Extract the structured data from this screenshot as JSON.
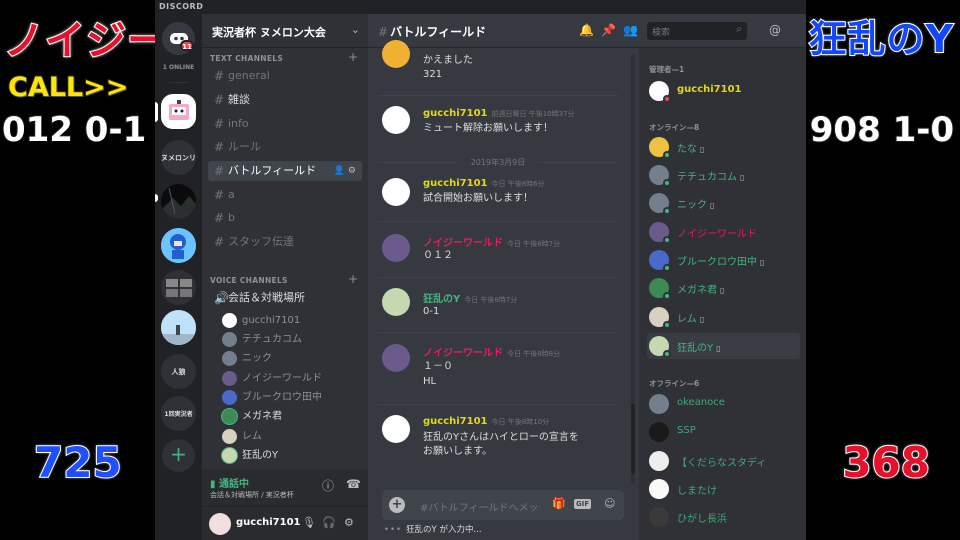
{
  "overlay": {
    "left_player": "ノイジー",
    "call": "CALL>>",
    "left_score": "012 0-1",
    "left_rate": "725",
    "right_player": "狂乱のY",
    "right_score": "908 1-0",
    "right_rate": "368"
  },
  "colors": {
    "accent_green": "#43b581",
    "mention_pink": "#e91e63",
    "name_green": "#43b581",
    "admin_yellow": "#e4d90b"
  },
  "titlebar": {
    "brand": "DISCORD"
  },
  "guilds": {
    "home_badge": "11",
    "online_label": "1 ONLINE",
    "items": [
      "ヌメロンリ",
      "人狼",
      "1回実況者"
    ]
  },
  "server": {
    "name": "実況者杯 ヌメロン大会",
    "text_category": "TEXT CHANNELS",
    "voice_category": "VOICE CHANNELS",
    "text_channels": [
      "general",
      "雑談",
      "info",
      "ルール",
      "バトルフィールド",
      "a",
      "b",
      "スタッフ伝達"
    ],
    "voice_channel": "会話＆対戦場所",
    "voice_users": [
      "gucchi7101",
      "テチュカコム",
      "ニック",
      "ノイジーワールド",
      "ブルークロウ田中",
      "メガネ君",
      "レム",
      "狂乱のY"
    ]
  },
  "voice_panel": {
    "title": "通話中",
    "subtitle": "会話＆対戦場所 / 実況者杯"
  },
  "user_panel": {
    "name": "gucchi7101"
  },
  "chat": {
    "channel": "バトルフィールド",
    "date_divider": "2019年3月9日",
    "messages": [
      {
        "text1": "かえました",
        "text2": "321"
      },
      {
        "user": "gucchi7101",
        "time": "前週日曜日 午後10時37分",
        "text1": "ミュート解除お願いします！"
      },
      {
        "user": "gucchi7101",
        "time": "今日 午後8時6分",
        "text1": "試合開始お願いします！"
      },
      {
        "user": "ノイジーワールド",
        "time": "今日 午後8時7分",
        "text1": "０１２"
      },
      {
        "user": "狂乱のY",
        "time": "今日 午後8時7分",
        "text1": "0-1"
      },
      {
        "user": "ノイジーワールド",
        "time": "今日 午後8時8分",
        "text1": "１－０",
        "text2": "HL"
      },
      {
        "user": "gucchi7101",
        "time": "今日 午後8時10分",
        "text1": "狂乱のYさんはハイとローの宣言を",
        "text2": "お願いします。"
      }
    ],
    "composer_placeholder": "#バトルフィールドへメッセージを送信",
    "typing": "狂乱のY が入力中..."
  },
  "header": {
    "search_placeholder": "検索"
  },
  "members": {
    "admin_label": "管理者—1",
    "online_label": "オンライン—8",
    "offline_label": "オフライン—6",
    "admin": "gucchi7101",
    "online": [
      "たな",
      "テチュカコム",
      "ニック",
      "ノイジーワールド",
      "ブルークロウ田中",
      "メガネ君",
      "レム",
      "狂乱のY"
    ],
    "offline": [
      "okeanoce",
      "SSP",
      "【くだらなスタディ",
      "しまたけ",
      "ひがし長浜"
    ]
  }
}
